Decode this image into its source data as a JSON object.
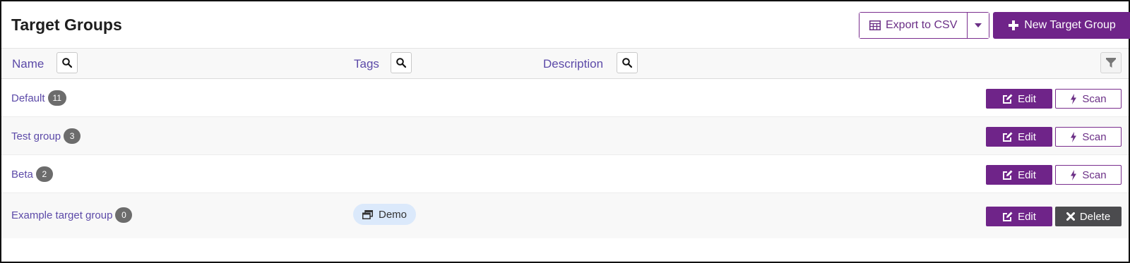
{
  "page": {
    "title": "Target Groups"
  },
  "toolbar": {
    "export_label": "Export to CSV",
    "new_label": "New Target Group"
  },
  "columns": {
    "name": "Name",
    "tags": "Tags",
    "description": "Description"
  },
  "rows": [
    {
      "name": "Default",
      "count": "11",
      "tag": "",
      "actions": [
        "Edit",
        "Scan"
      ]
    },
    {
      "name": "Test group",
      "count": "3",
      "tag": "",
      "actions": [
        "Edit",
        "Scan"
      ]
    },
    {
      "name": "Beta",
      "count": "2",
      "tag": "",
      "actions": [
        "Edit",
        "Scan"
      ]
    },
    {
      "name": "Example target group",
      "count": "0",
      "tag": "Demo",
      "actions": [
        "Edit",
        "Delete"
      ]
    }
  ],
  "colors": {
    "accent": "#6f2489",
    "link": "#5c4aa8",
    "badge": "#6c6c6c",
    "tag_bg": "#dbe9fb",
    "delete": "#4b4b4e"
  },
  "icons": {
    "export": "table-icon",
    "new": "plus-icon",
    "search": "search-icon",
    "filter": "filter-icon",
    "edit": "edit-icon",
    "scan": "bolt-icon",
    "delete": "x-icon",
    "tag": "window-restore-icon"
  }
}
